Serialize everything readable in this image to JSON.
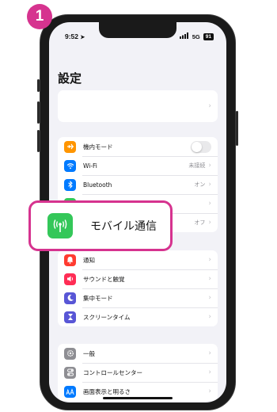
{
  "step_badge": "1",
  "status_bar": {
    "time": "9:52",
    "network": "5G",
    "battery": "91"
  },
  "page_title": "設定",
  "group_connectivity": [
    {
      "icon": "airplane-icon",
      "color": "#ff9500",
      "label": "機内モード",
      "value": "",
      "toggle": "off"
    },
    {
      "icon": "wifi-icon",
      "color": "#007aff",
      "label": "Wi-Fi",
      "value": "未接続"
    },
    {
      "icon": "bluetooth-icon",
      "color": "#007aff",
      "label": "Bluetooth",
      "value": "オン"
    },
    {
      "icon": "cellular-icon",
      "color": "#34c759",
      "label": "",
      "value": ""
    },
    {
      "icon": "hotspot-icon",
      "color": "#34c759",
      "label": "",
      "value": "オフ"
    }
  ],
  "group_notifications": [
    {
      "icon": "bell-icon",
      "color": "#ff3b30",
      "label": "通知"
    },
    {
      "icon": "speaker-icon",
      "color": "#ff2d55",
      "label": "サウンドと触覚"
    },
    {
      "icon": "moon-icon",
      "color": "#5856d6",
      "label": "集中モード"
    },
    {
      "icon": "hourglass-icon",
      "color": "#5856d6",
      "label": "スクリーンタイム"
    }
  ],
  "group_general": [
    {
      "icon": "gear-icon",
      "color": "#8e8e93",
      "label": "一般"
    },
    {
      "icon": "control-center-icon",
      "color": "#8e8e93",
      "label": "コントロールセンター"
    },
    {
      "icon": "display-icon",
      "color": "#007aff",
      "label": "画面表示と明るさ"
    }
  ],
  "callout": {
    "icon": "cellular-icon",
    "color": "#34c759",
    "label": "モバイル通信"
  },
  "colors": {
    "highlight": "#d6338f",
    "phone_frame": "#1a1a1a",
    "screen_bg": "#f2f2f7"
  }
}
